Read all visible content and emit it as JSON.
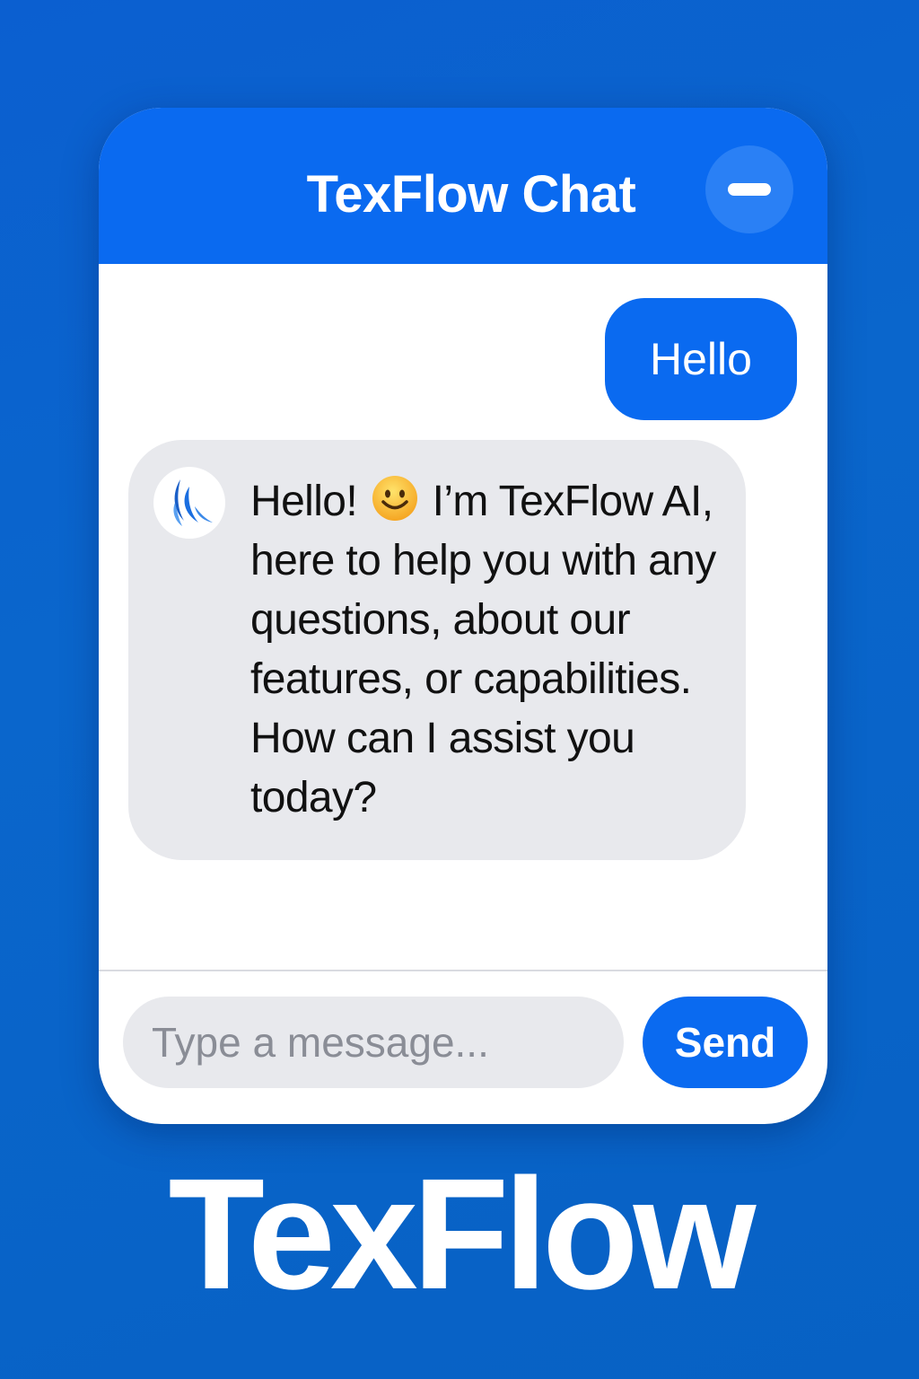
{
  "header": {
    "title": "TexFlow Chat",
    "minimize_icon": "minus-icon"
  },
  "messages": [
    {
      "sender": "user",
      "text": "Hello"
    },
    {
      "sender": "bot",
      "avatar_icon": "texflow-logo-icon",
      "text_before_emoji": "Hello!",
      "emoji": "smiling-face-icon",
      "text_after_emoji": "I’m TexFlow AI, here to help you with any questions, about our features, or capabilities. How can I assist you today?"
    }
  ],
  "composer": {
    "placeholder": "Type a message...",
    "send_label": "Send"
  },
  "brand": {
    "wordmark": "TexFlow"
  },
  "colors": {
    "background": "#0a66cc",
    "accent": "#0a6af0",
    "bot_bubble": "#e8e9ed",
    "input_bg": "#e8e9ed"
  }
}
